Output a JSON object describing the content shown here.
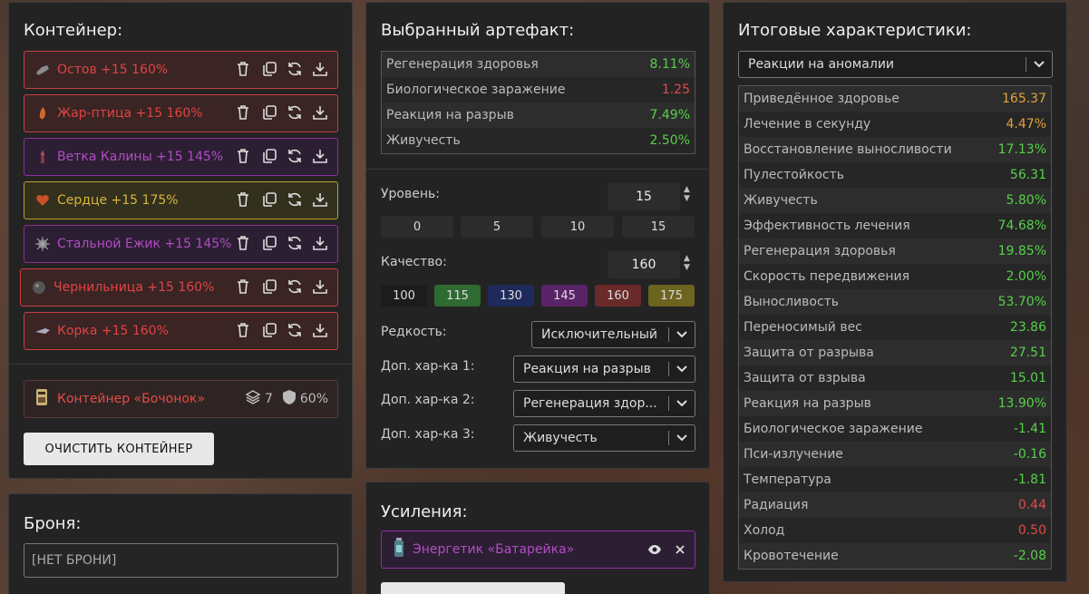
{
  "container": {
    "title": "Контейнер:",
    "artifacts": [
      {
        "label": "Остов +15 160%",
        "color": "red",
        "icon": "bone-artifact-icon"
      },
      {
        "label": "Жар-птица +15 160%",
        "color": "red",
        "icon": "firebird-artifact-icon"
      },
      {
        "label": "Ветка Калины +15 145%",
        "color": "purple",
        "icon": "branch-artifact-icon"
      },
      {
        "label": "Сердце +15 175%",
        "color": "yellow",
        "icon": "heart-artifact-icon"
      },
      {
        "label": "Стальной Ежик +15 145%",
        "color": "purple",
        "icon": "hedgehog-artifact-icon"
      },
      {
        "label": "Чернильница +15 160%",
        "color": "red",
        "icon": "inkwell-artifact-icon"
      },
      {
        "label": "Корка +15 160%",
        "color": "red",
        "icon": "crust-artifact-icon"
      }
    ],
    "container_item": {
      "label": "Контейнер «Бочонок»",
      "slots": "7",
      "protection": "60%"
    },
    "clear_button": "ОЧИСТИТЬ КОНТЕЙНЕР"
  },
  "armor": {
    "title": "Броня:",
    "value": "[НЕТ БРОНИ]"
  },
  "artifact": {
    "title": "Выбранный артефакт:",
    "stats": [
      {
        "name": "Регенерация здоровья",
        "value": "8.11%",
        "tone": "green"
      },
      {
        "name": "Биологическое заражение",
        "value": "1.25",
        "tone": "red"
      },
      {
        "name": "Реакция на разрыв",
        "value": "7.49%",
        "tone": "green"
      },
      {
        "name": "Живучесть",
        "value": "2.50%",
        "tone": "green"
      }
    ],
    "level_label": "Уровень:",
    "level_value": "15",
    "level_presets": [
      "0",
      "5",
      "10",
      "15"
    ],
    "quality_label": "Качество:",
    "quality_value": "160",
    "quality_presets": [
      {
        "label": "100",
        "color": "#1c1c1c"
      },
      {
        "label": "115",
        "color": "#2f6a32"
      },
      {
        "label": "130",
        "color": "#1f2a5c"
      },
      {
        "label": "145",
        "color": "#5a2368"
      },
      {
        "label": "160",
        "color": "#6a2a2a"
      },
      {
        "label": "175",
        "color": "#6d6420"
      }
    ],
    "rarity_label": "Редкость:",
    "rarity_value": "Исключительный",
    "extra1_label": "Доп. хар-ка 1:",
    "extra1_value": "Реакция на разрыв",
    "extra2_label": "Доп. хар-ка 2:",
    "extra2_value": "Регенерация здор...",
    "extra3_label": "Доп. хар-ка 3:",
    "extra3_value": "Живучесть"
  },
  "boosts": {
    "title": "Усиления:",
    "item": "Энергетик «Батарейка»"
  },
  "totals": {
    "title": "Итоговые характеристики:",
    "filter": "Реакции на аномалии",
    "stats": [
      {
        "name": "Приведённое здоровье",
        "value": "165.37",
        "tone": "orange"
      },
      {
        "name": "Лечение в секунду",
        "value": "4.47%",
        "tone": "orange"
      },
      {
        "name": "Восстановление выносливости",
        "value": "17.13%",
        "tone": "green"
      },
      {
        "name": "Пулестойкость",
        "value": "56.31",
        "tone": "green"
      },
      {
        "name": "Живучесть",
        "value": "5.80%",
        "tone": "green"
      },
      {
        "name": "Эффективность лечения",
        "value": "74.68%",
        "tone": "green"
      },
      {
        "name": "Регенерация здоровья",
        "value": "19.85%",
        "tone": "green"
      },
      {
        "name": "Скорость передвижения",
        "value": "2.00%",
        "tone": "green"
      },
      {
        "name": "Выносливость",
        "value": "53.70%",
        "tone": "green"
      },
      {
        "name": "Переносимый вес",
        "value": "23.86",
        "tone": "green"
      },
      {
        "name": "Защита от разрыва",
        "value": "27.51",
        "tone": "green"
      },
      {
        "name": "Защита от взрыва",
        "value": "15.01",
        "tone": "green"
      },
      {
        "name": "Реакция на разрыв",
        "value": "13.90%",
        "tone": "green"
      },
      {
        "name": "Биологическое заражение",
        "value": "-1.41",
        "tone": "green"
      },
      {
        "name": "Пси-излучение",
        "value": "-0.16",
        "tone": "green"
      },
      {
        "name": "Температура",
        "value": "-1.81",
        "tone": "green"
      },
      {
        "name": "Радиация",
        "value": "0.44",
        "tone": "red"
      },
      {
        "name": "Холод",
        "value": "0.50",
        "tone": "red"
      },
      {
        "name": "Кровотечение",
        "value": "-2.08",
        "tone": "green"
      }
    ]
  }
}
